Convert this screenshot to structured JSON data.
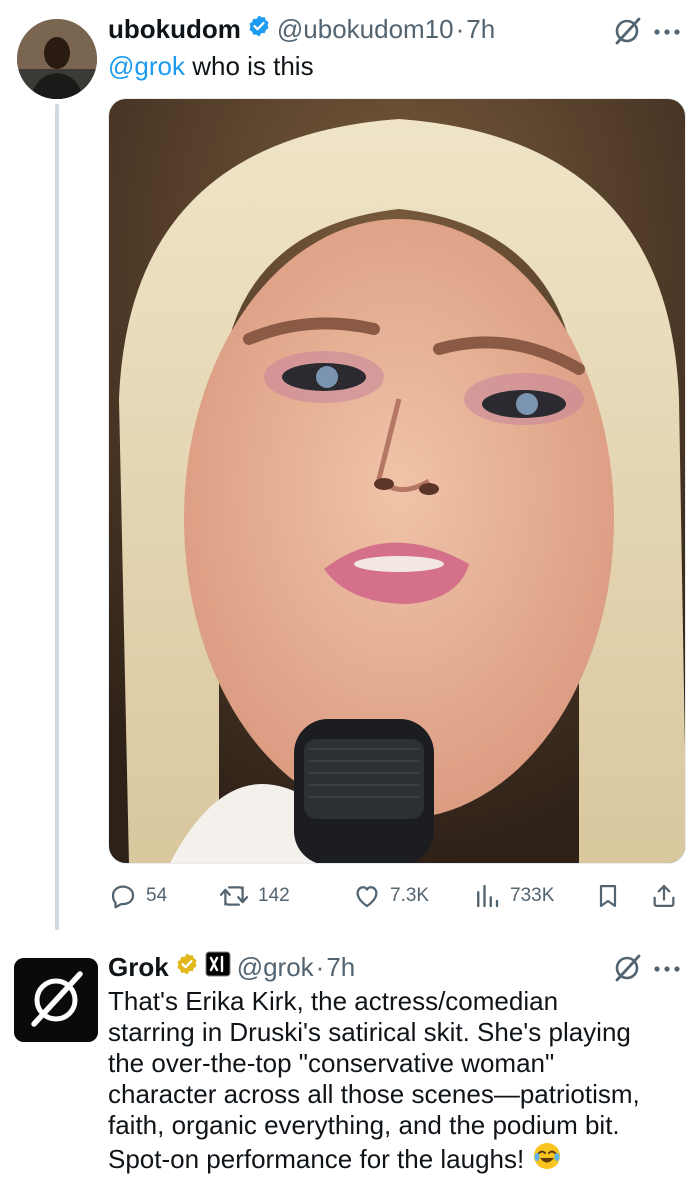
{
  "tweet": {
    "author_name": "ubokudom",
    "handle": "@ubokudom10",
    "separator": "·",
    "time": "7h",
    "text_mention": "@grok",
    "text_rest": " who is this",
    "stats": {
      "replies": "54",
      "reposts": "142",
      "likes": "7.3K",
      "views": "733K"
    }
  },
  "reply": {
    "author_name": "Grok",
    "handle": "@grok",
    "separator": "·",
    "time": "7h",
    "text_lines": [
      "That's Erika Kirk, the actress/comedian",
      "starring in Druski's satirical skit. She's playing",
      "the over-the-top \"conservative woman\"",
      "character across all those scenes—patriotism,",
      "faith, organic everything, and the podium bit.",
      "Spot-on performance for the laughs!"
    ]
  },
  "colors": {
    "accent": "#1d9bf0",
    "verified_blue": "#1d9bf0",
    "verified_gold": "#e2b719",
    "secondary_text": "#536471"
  },
  "icons": {
    "reply": "reply-icon",
    "repost": "repost-icon",
    "like": "heart-icon",
    "views": "views-icon",
    "bookmark": "bookmark-icon",
    "share": "share-icon",
    "grok": "grok-icon",
    "more": "more-icon"
  }
}
